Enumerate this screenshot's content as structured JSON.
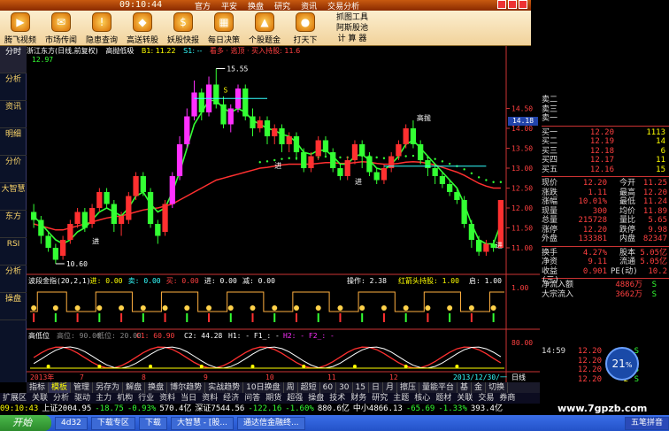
{
  "menubar": {
    "clock": "09:10:44",
    "menus": [
      "官方",
      "平安",
      "换盘",
      "研究",
      "资讯",
      "交易分析"
    ]
  },
  "toolbar": {
    "buttons": [
      {
        "label": "腾飞视频",
        "icon": "video-icon"
      },
      {
        "label": "市场传闻",
        "icon": "news-icon"
      },
      {
        "label": "隐患查询",
        "icon": "warning-icon"
      },
      {
        "label": "高送转股",
        "icon": "stock-icon"
      },
      {
        "label": "妖股快报",
        "icon": "money-icon"
      },
      {
        "label": "每日决策",
        "icon": "calendar-icon"
      },
      {
        "label": "个股题金",
        "icon": "chart-icon"
      },
      {
        "label": "打天下",
        "icon": "globe-icon"
      }
    ],
    "right_tools": [
      "抓图工具",
      "阿斯股池",
      "计 算 器"
    ]
  },
  "left_tabs": [
    "分时",
    "分析",
    "资讯",
    "明细",
    "分价",
    "大智慧",
    "东方",
    "RSI",
    "分析",
    "操盘"
  ],
  "main_header": {
    "name": "浙江东方(日线,前复权)",
    "indicator": "高抛低吸",
    "b1": "B1: 11.22",
    "s1": "S1: --",
    "extra": "看多 · 逃顶 · 买入持股: 11.6"
  },
  "chart_labels": {
    "high": "15.55",
    "low": "10.60",
    "cur": "12.97",
    "sell_marker": "高抛",
    "buy_marker": "进",
    "sell2": "S"
  },
  "price_axis": [
    "14.50",
    "14.18",
    "14.00",
    "13.50",
    "13.00",
    "12.50",
    "12.00",
    "11.50",
    "11.00"
  ],
  "price_tag": "14.18",
  "ind1": {
    "header": "波段金指(20,2,1)",
    "buy": "进: 0.00",
    "sell": "卖: 0.00",
    "buy2": "买: 0.00",
    "in": "进: 0.00",
    "jian": "减: 0.00",
    "op": "操作: 2.38",
    "hold": "红箭头持股: 1.00",
    "qi": "启: 1.00",
    "axis_val": "1.00"
  },
  "ind2": {
    "header": "高低位",
    "hi": "高位: 90.00",
    "lo": "低位: 20.00",
    "c1": "C1: 60.90",
    "c2": "C2: 44.28",
    "h1": "H1: - F1_: -",
    "h2": "H2: - F2_: -",
    "axis_val": "80.00"
  },
  "date_labels": [
    "2013年",
    "7",
    "8",
    "9",
    "10",
    "11",
    "12",
    "2013/12/30/一"
  ],
  "date_right": "日线",
  "quote": {
    "sell": [
      {
        "label": "卖二",
        "price": "",
        "vol": ""
      },
      {
        "label": "卖三",
        "price": "",
        "vol": ""
      },
      {
        "label": "卖一",
        "price": "",
        "vol": ""
      }
    ],
    "buy": [
      {
        "label": "买一",
        "price": "12.20",
        "vol": "1113"
      },
      {
        "label": "买二",
        "price": "12.19",
        "vol": "14"
      },
      {
        "label": "买三",
        "price": "12.18",
        "vol": "6"
      },
      {
        "label": "买四",
        "price": "12.17",
        "vol": "11"
      },
      {
        "label": "买五",
        "price": "12.16",
        "vol": "15"
      }
    ],
    "stats": [
      {
        "k": "现价",
        "v": "12.20",
        "k2": "今开",
        "v2": "11.25"
      },
      {
        "k": "涨跌",
        "v": "1.11",
        "k2": "最高",
        "v2": "12.20"
      },
      {
        "k": "涨幅",
        "v": "10.01%",
        "k2": "最低",
        "v2": "11.24"
      },
      {
        "k": "现量",
        "v": "300",
        "k2": "均价",
        "v2": "11.89"
      },
      {
        "k": "总量",
        "v": "215728",
        "k2": "量比",
        "v2": "5.65"
      },
      {
        "k": "涨停",
        "v": "12.20",
        "k2": "跌停",
        "v2": "9.98"
      },
      {
        "k": "外盘",
        "v": "133381",
        "k2": "内盘",
        "v2": "82347"
      }
    ],
    "stats2": [
      {
        "k": "换手",
        "v": "4.27%",
        "k2": "股本",
        "v2": "5.05亿"
      },
      {
        "k": "净资",
        "v": "9.11",
        "k2": "流通",
        "v2": "5.05亿"
      },
      {
        "k": "收益(三)",
        "v": "0.901",
        "k2": "PE(动)",
        "v2": "10.2"
      }
    ],
    "flows": [
      {
        "k": "净流入额",
        "v": "4886万",
        "s": "S"
      },
      {
        "k": "大宗流入",
        "v": "3662万",
        "s": "S"
      }
    ]
  },
  "ticks": [
    {
      "t": "14:59",
      "p": "12.20",
      "v": "13",
      "s": "S"
    },
    {
      "t": "",
      "p": "12.20",
      "v": "5",
      "s": "S"
    },
    {
      "t": "",
      "p": "12.20",
      "v": "2",
      "s": "S"
    },
    {
      "t": "",
      "p": "12.20",
      "v": "2",
      "s": "S"
    }
  ],
  "badge": "21",
  "badge_unit": "%",
  "bottom_tabs": [
    "指标",
    "模板",
    "管理",
    "另存为",
    "解盘",
    "换盘",
    "博尔趋势",
    "实战趋势",
    "10日换盘",
    "周",
    "超短",
    "60",
    "30",
    "15",
    "日",
    "月",
    "擦压",
    "量能平台",
    "基",
    "金",
    "切换"
  ],
  "sub_tabs": [
    "扩展区",
    "关联",
    "分析",
    "驱动",
    "主力",
    "机构",
    "行业",
    "资料",
    "当日",
    "资料",
    "经济",
    "问答",
    "期货",
    "超强",
    "操盘",
    "技术",
    "财务",
    "研究",
    "主题",
    "核心",
    "题材",
    "关联",
    "交易",
    "券商"
  ],
  "status": [
    {
      "t": "09:10:43",
      "c": "yellow"
    },
    {
      "t": "上证2004.95",
      "c": "white"
    },
    {
      "t": "-18.75",
      "c": "green"
    },
    {
      "t": "-0.93%",
      "c": "green"
    },
    {
      "t": "570.4亿",
      "c": "white"
    },
    {
      "t": "深证7544.56",
      "c": "white"
    },
    {
      "t": "-122.16",
      "c": "green"
    },
    {
      "t": "-1.60%",
      "c": "green"
    },
    {
      "t": "880.6亿",
      "c": "white"
    },
    {
      "t": "中小4866.13",
      "c": "white"
    },
    {
      "t": "-65.69",
      "c": "green"
    },
    {
      "t": "-1.33%",
      "c": "green"
    },
    {
      "t": "393.4亿",
      "c": "white"
    }
  ],
  "taskbar": {
    "start": "开始",
    "tasks": [
      "4d32",
      "下载专区",
      "下载",
      "大智慧 - [股...",
      "通达信金融终..."
    ],
    "ime": "五笔拼音"
  },
  "watermark": "www.7gpzb.com",
  "colors": {
    "up": "#ff4040",
    "down": "#33ff33",
    "text": "#dddddd",
    "accent": "#ffff00"
  },
  "chart_data": {
    "type": "candlestick",
    "ylim": [
      10.4,
      15.8
    ],
    "candles": [
      [
        11.9,
        11.7,
        12.1,
        11.5
      ],
      [
        11.7,
        11.3,
        11.8,
        11.1
      ],
      [
        11.3,
        11.0,
        11.4,
        10.9
      ],
      [
        11.0,
        10.7,
        11.1,
        10.6
      ],
      [
        10.8,
        11.2,
        11.3,
        10.7
      ],
      [
        11.2,
        11.6,
        11.7,
        11.1
      ],
      [
        11.6,
        11.9,
        12.0,
        11.5
      ],
      [
        11.9,
        11.5,
        12.0,
        11.4
      ],
      [
        11.6,
        12.0,
        12.1,
        11.5
      ],
      [
        12.0,
        12.4,
        12.5,
        11.9
      ],
      [
        12.4,
        12.1,
        12.5,
        12.0
      ],
      [
        12.1,
        11.6,
        12.2,
        11.4
      ],
      [
        11.6,
        11.8,
        11.9,
        11.3
      ],
      [
        11.7,
        12.3,
        12.4,
        11.6
      ],
      [
        12.3,
        12.8,
        12.9,
        12.2
      ],
      [
        12.8,
        12.4,
        12.9,
        12.3
      ],
      [
        12.4,
        11.6,
        12.5,
        11.5
      ],
      [
        11.6,
        11.3,
        11.7,
        11.1
      ],
      [
        11.4,
        12.1,
        12.2,
        11.3
      ],
      [
        12.1,
        12.8,
        12.9,
        12.0
      ],
      [
        12.8,
        13.6,
        13.8,
        12.7
      ],
      [
        13.6,
        14.3,
        14.5,
        13.5
      ],
      [
        14.3,
        14.9,
        15.2,
        14.2
      ],
      [
        14.9,
        14.4,
        15.0,
        14.2
      ],
      [
        14.4,
        15.1,
        15.3,
        14.3
      ],
      [
        15.1,
        14.6,
        15.5,
        14.5
      ],
      [
        14.6,
        14.1,
        14.8,
        14.0
      ],
      [
        14.1,
        14.5,
        14.6,
        13.9
      ],
      [
        14.5,
        15.0,
        15.1,
        14.4
      ],
      [
        15.0,
        14.3,
        15.1,
        14.2
      ],
      [
        14.3,
        14.0,
        14.5,
        13.8
      ],
      [
        14.0,
        14.2,
        14.3,
        13.9
      ],
      [
        14.2,
        13.8,
        14.3,
        13.6
      ],
      [
        13.8,
        14.0,
        14.1,
        13.6
      ],
      [
        14.0,
        13.6,
        14.1,
        13.4
      ],
      [
        13.6,
        13.8,
        13.9,
        13.4
      ],
      [
        13.8,
        13.4,
        13.9,
        13.2
      ],
      [
        13.4,
        13.0,
        13.5,
        12.9
      ],
      [
        13.0,
        13.3,
        13.4,
        12.9
      ],
      [
        13.3,
        13.7,
        13.8,
        13.2
      ],
      [
        13.7,
        13.4,
        13.8,
        13.3
      ],
      [
        13.4,
        13.0,
        13.5,
        12.9
      ],
      [
        13.0,
        12.8,
        13.1,
        12.7
      ],
      [
        12.8,
        13.2,
        13.3,
        12.7
      ],
      [
        13.2,
        13.6,
        13.7,
        13.1
      ],
      [
        13.6,
        13.3,
        13.7,
        13.0
      ],
      [
        13.3,
        12.9,
        13.4,
        12.8
      ],
      [
        12.9,
        12.7,
        13.0,
        12.6
      ],
      [
        12.7,
        13.0,
        13.1,
        12.6
      ],
      [
        13.0,
        13.3,
        13.4,
        12.9
      ],
      [
        13.3,
        13.6,
        13.7,
        13.2
      ],
      [
        13.6,
        14.0,
        14.1,
        13.5
      ],
      [
        14.0,
        13.6,
        14.2,
        13.5
      ],
      [
        13.6,
        13.2,
        13.7,
        13.1
      ],
      [
        13.2,
        13.0,
        13.3,
        12.8
      ],
      [
        13.0,
        12.8,
        13.1,
        12.6
      ],
      [
        12.8,
        12.6,
        12.9,
        12.5
      ],
      [
        12.6,
        12.4,
        12.7,
        12.3
      ],
      [
        12.4,
        12.2,
        12.5,
        12.1
      ],
      [
        12.2,
        11.6,
        12.3,
        11.5
      ],
      [
        11.6,
        11.2,
        11.7,
        11.0
      ],
      [
        11.2,
        10.9,
        11.3,
        10.8
      ],
      [
        10.9,
        11.1,
        11.2,
        10.8
      ],
      [
        11.1,
        11.0,
        11.2,
        10.9
      ],
      [
        11.0,
        12.2,
        12.2,
        11.0
      ]
    ],
    "ma_slow": [
      11.6,
      11.55,
      11.5,
      11.45,
      11.45,
      11.5,
      11.55,
      11.6,
      11.65,
      11.7,
      11.75,
      11.78,
      11.8,
      11.85,
      11.9,
      11.95,
      11.98,
      12.0,
      12.05,
      12.1,
      12.2,
      12.3,
      12.4,
      12.5,
      12.6,
      12.7,
      12.75,
      12.8,
      12.85,
      12.9,
      12.95,
      13.0,
      13.02,
      13.05,
      13.08,
      13.1,
      13.1,
      13.1,
      13.1,
      13.12,
      13.14,
      13.14,
      13.12,
      13.12,
      13.14,
      13.16,
      13.15,
      13.12,
      13.1,
      13.1,
      13.12,
      13.15,
      13.16,
      13.15,
      13.12,
      13.08,
      13.02,
      12.96,
      12.9,
      12.82,
      12.72,
      12.62,
      12.55,
      12.5,
      12.5
    ],
    "ma_fast": [
      11.8,
      11.6,
      11.4,
      11.2,
      11.1,
      11.2,
      11.4,
      11.5,
      11.7,
      11.9,
      12.0,
      11.9,
      11.8,
      12.0,
      12.3,
      12.4,
      12.1,
      11.9,
      12.0,
      12.4,
      12.9,
      13.5,
      14.1,
      14.4,
      14.7,
      14.7,
      14.5,
      14.4,
      14.5,
      14.4,
      14.2,
      14.1,
      14.0,
      13.95,
      13.85,
      13.8,
      13.65,
      13.4,
      13.35,
      13.45,
      13.45,
      13.3,
      13.1,
      13.1,
      13.3,
      13.35,
      13.2,
      13.0,
      12.95,
      13.1,
      13.3,
      13.6,
      13.7,
      13.5,
      13.3,
      13.1,
      12.9,
      12.7,
      12.5,
      12.1,
      11.6,
      11.2,
      11.1,
      11.1,
      11.6
    ]
  }
}
